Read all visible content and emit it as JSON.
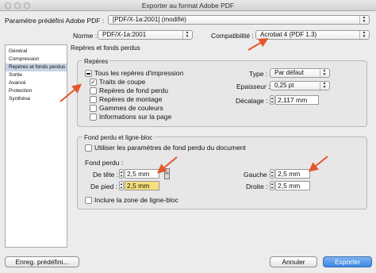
{
  "window": {
    "title": "Exporter au format Adobe PDF"
  },
  "top": {
    "preset_label": "Paramètre prédéfini Adobe PDF :",
    "preset_value": "[PDF/X-1a:2001] (modifié)",
    "norm_label": "Norme :",
    "norm_value": "PDF/X-1a:2001",
    "compat_label": "Compatibilité :",
    "compat_value": "Acrobat 4 (PDF 1.3)"
  },
  "sidebar": {
    "items": [
      {
        "label": "Général"
      },
      {
        "label": "Compression"
      },
      {
        "label": "Repères et fonds perdus"
      },
      {
        "label": "Sortie"
      },
      {
        "label": "Avancé"
      },
      {
        "label": "Protection"
      },
      {
        "label": "Synthèse"
      }
    ],
    "selected": 2
  },
  "panel": {
    "header": "Repères et fonds perdus",
    "marks": {
      "title": "Repères",
      "all_marks": "Tous les repères d'impression",
      "crop": "Traits de coupe",
      "bleed": "Repères de fond perdu",
      "registration": "Repères de montage",
      "color_bars": "Gammes de couleurs",
      "page_info": "Informations sur la page",
      "type_label": "Type :",
      "type_value": "Par défaut",
      "weight_label": "Epaisseur :",
      "weight_value": "0,25 pt",
      "offset_label": "Décalage :",
      "offset_value": "2,117 mm"
    },
    "bleed": {
      "title": "Fond perdu et ligne-bloc",
      "use_doc": "Utiliser les paramètres de fond perdu du document",
      "subtitle": "Fond perdu :",
      "top_label": "De tête :",
      "top_value": "2,5 mm",
      "bottom_label": "De pied :",
      "bottom_value": "2,5 mm",
      "left_label": "Gauche :",
      "left_value": "2,5 mm",
      "right_label": "Droite :",
      "right_value": "2,5 mm",
      "slug": "Inclure la zone de ligne-bloc"
    }
  },
  "buttons": {
    "save_preset": "Enreg. prédéfini...",
    "cancel": "Annuler",
    "export": "Exporter"
  },
  "colors": {
    "accent": "#3b86e2",
    "annotation": "#e4572e",
    "highlight": "#f6e07a"
  }
}
